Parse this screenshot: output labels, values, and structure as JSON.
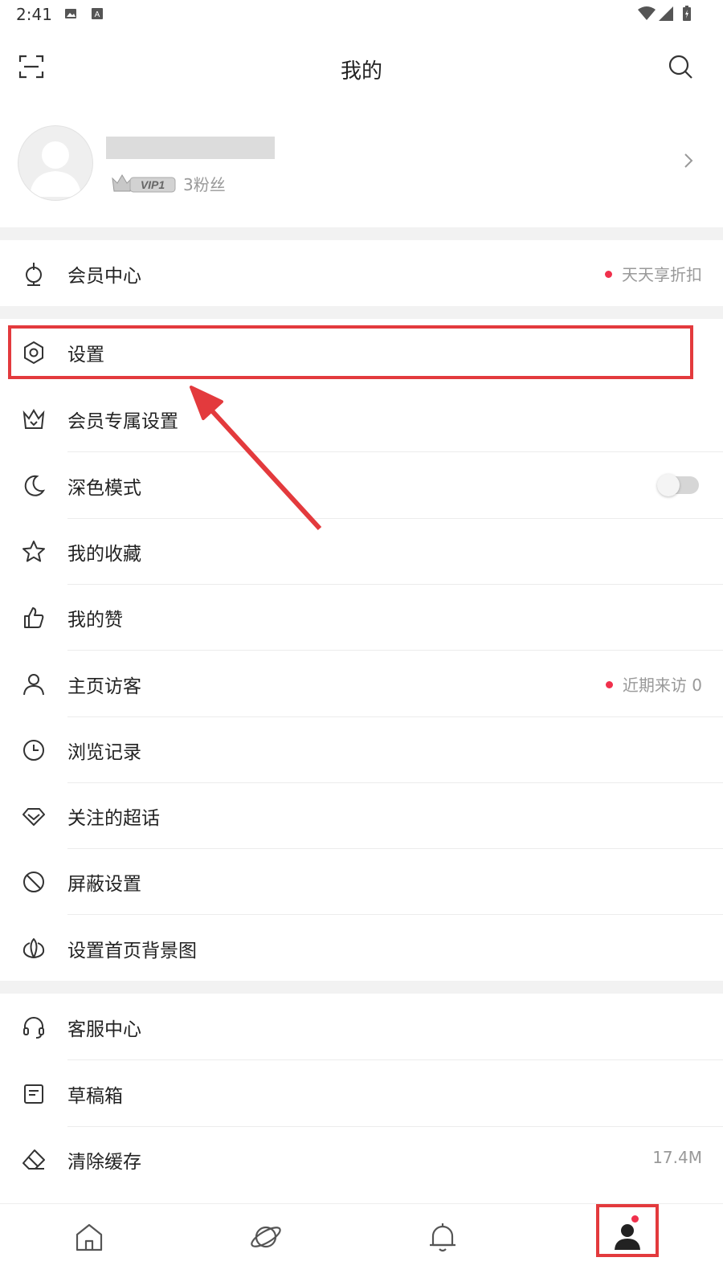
{
  "status": {
    "time": "2:41"
  },
  "header": {
    "title": "我的"
  },
  "profile": {
    "vip_label": "VIP1",
    "fans": "3粉丝"
  },
  "menu": {
    "member_center": {
      "label": "会员中心",
      "right": "天天享折扣"
    },
    "settings": {
      "label": "设置"
    },
    "member_settings": {
      "label": "会员专属设置"
    },
    "dark_mode": {
      "label": "深色模式",
      "enabled": false
    },
    "favorites": {
      "label": "我的收藏"
    },
    "likes": {
      "label": "我的赞"
    },
    "visitors": {
      "label": "主页访客",
      "right": "近期来访 0"
    },
    "history": {
      "label": "浏览记录"
    },
    "super_topics": {
      "label": "关注的超话"
    },
    "block_settings": {
      "label": "屏蔽设置"
    },
    "homepage_bg": {
      "label": "设置首页背景图"
    },
    "service_center": {
      "label": "客服中心"
    },
    "drafts": {
      "label": "草稿箱"
    },
    "clear_cache": {
      "label": "清除缓存",
      "right": "17.4M"
    }
  },
  "tabbar": {
    "items": [
      {
        "icon": "home-icon"
      },
      {
        "icon": "planet-icon"
      },
      {
        "icon": "bell-icon"
      },
      {
        "icon": "profile-icon",
        "active": true
      }
    ]
  },
  "colors": {
    "accent": "#f0304c",
    "annotation": "#e33a3d"
  }
}
